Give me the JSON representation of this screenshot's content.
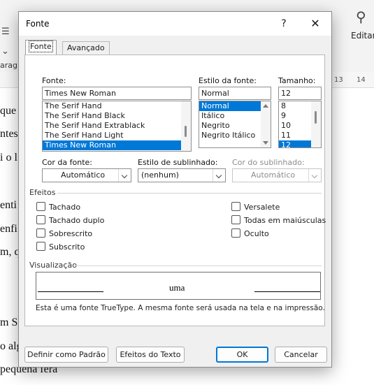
{
  "background": {
    "ruler_numbers": [
      "13",
      "14"
    ],
    "editing_label": "Editan",
    "paragraph_label": "aragr",
    "doc_lines": [
      "que n",
      "ntes.",
      "i o l",
      "enti",
      "enfi",
      "m, q",
      "m Sl",
      "o alg",
      "pequena fera"
    ]
  },
  "dialog": {
    "title": "Fonte",
    "help_label": "?",
    "close_label": "✕",
    "tabs": [
      {
        "label": "Fonte",
        "active": true
      },
      {
        "label": "Avançado",
        "active": false
      }
    ],
    "font": {
      "label": "Fonte:",
      "value": "Times New Roman",
      "options": [
        "The Serif Hand",
        "The Serif Hand Black",
        "The Serif Hand Extrablack",
        "The Serif Hand Light",
        "Times New Roman"
      ],
      "selected": "Times New Roman"
    },
    "style": {
      "label": "Estilo da fonte:",
      "value": "Normal",
      "options": [
        "Normal",
        "Itálico",
        "Negrito",
        "Negrito Itálico"
      ],
      "selected": "Normal"
    },
    "size": {
      "label": "Tamanho:",
      "value": "12",
      "options": [
        "8",
        "9",
        "10",
        "11",
        "12"
      ],
      "selected": "12"
    },
    "font_color": {
      "label": "Cor da fonte:",
      "value": "Automático"
    },
    "underline_style": {
      "label": "Estilo de sublinhado:",
      "value": "(nenhum)"
    },
    "underline_color": {
      "label": "Cor do sublinhado:",
      "value": "Automático",
      "disabled": true
    },
    "effects": {
      "label": "Efeitos",
      "left": [
        "Tachado",
        "Tachado duplo",
        "Sobrescrito",
        "Subscrito"
      ],
      "right": [
        "Versalete",
        "Todas em maiúsculas",
        "Oculto"
      ]
    },
    "preview": {
      "label": "Visualização",
      "sample": "uma",
      "note": "Esta é uma fonte TrueType. A mesma fonte será usada na tela e na impressão."
    },
    "buttons": {
      "set_default": "Definir como Padrão",
      "text_effects": "Efeitos do Texto",
      "ok": "OK",
      "cancel": "Cancelar"
    }
  },
  "colors": {
    "selection": "#0078d7",
    "dialog_bg": "#f0f0f0",
    "accent_border": "#0078d7"
  }
}
